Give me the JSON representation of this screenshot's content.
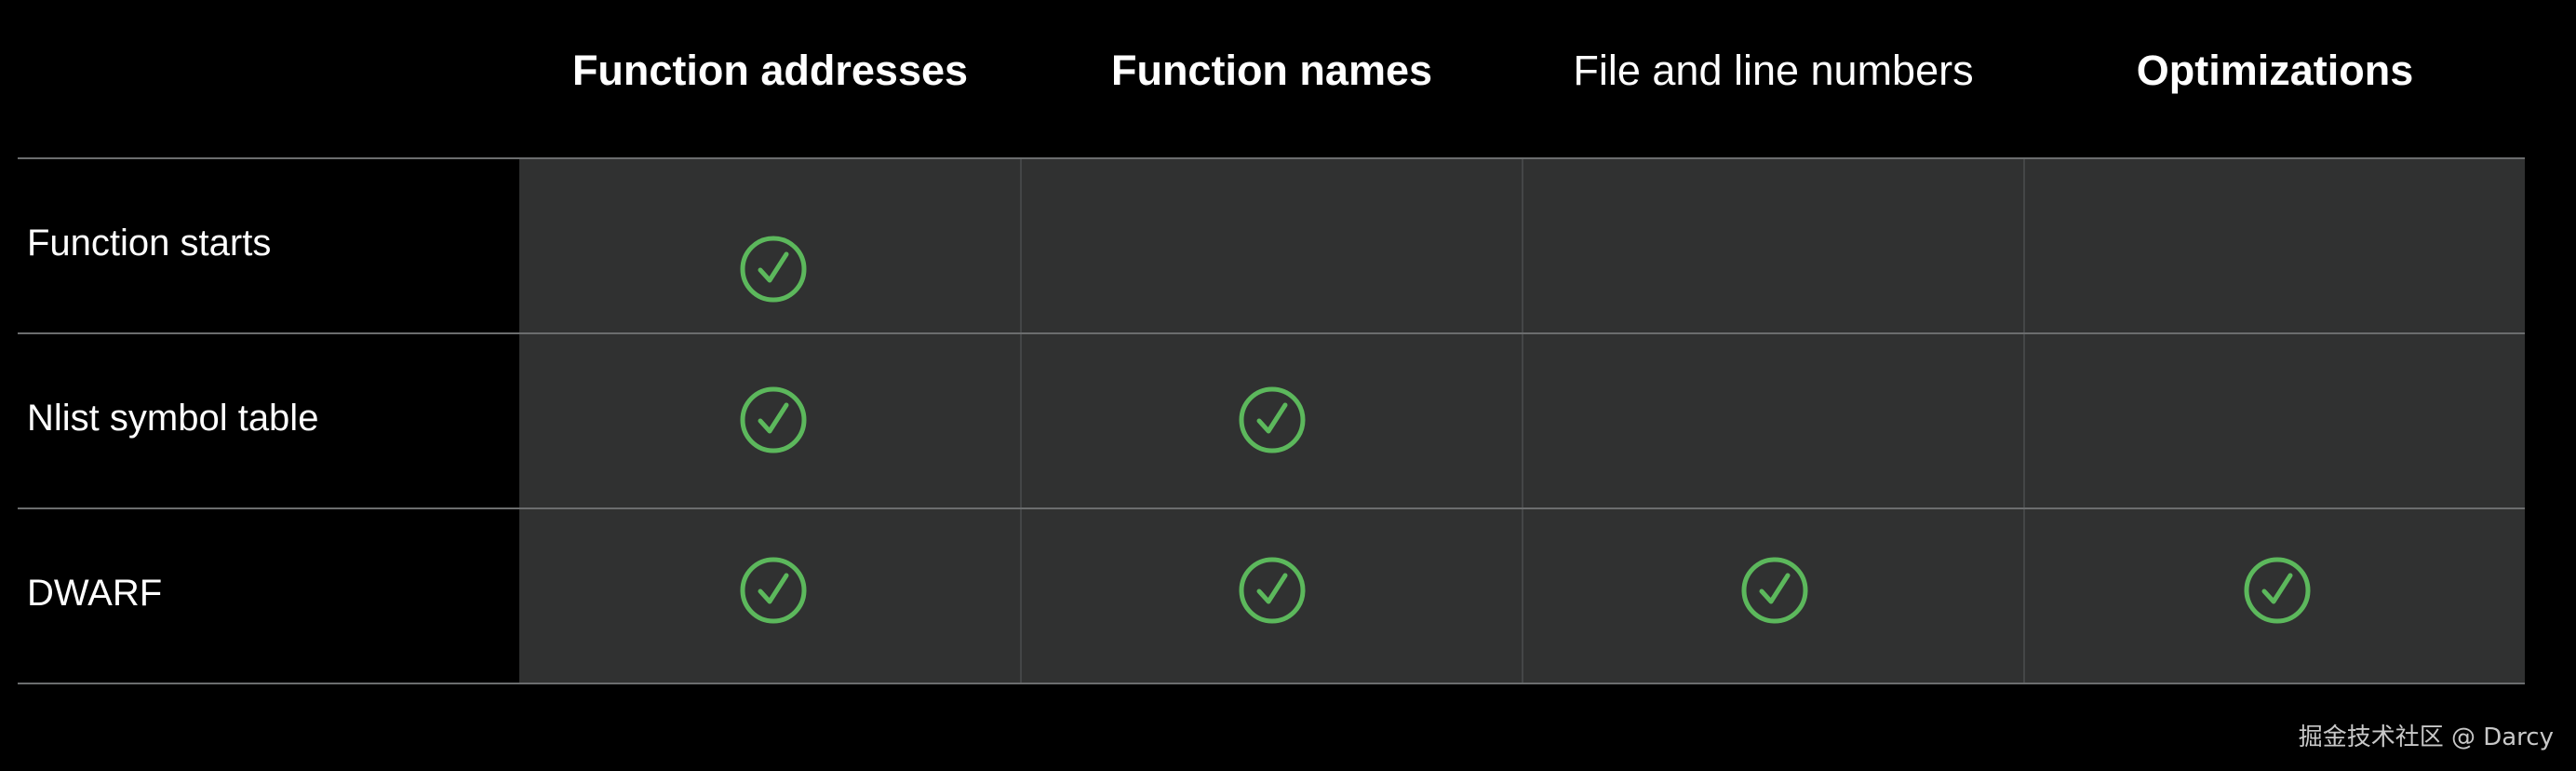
{
  "columns": [
    {
      "label": "Function addresses"
    },
    {
      "label": "Function names"
    },
    {
      "label": "File and line numbers"
    },
    {
      "label": "Optimizations"
    }
  ],
  "rows": [
    {
      "label": "Function starts",
      "checks": [
        true,
        false,
        false,
        false
      ]
    },
    {
      "label": "Nlist symbol table",
      "checks": [
        true,
        true,
        false,
        false
      ]
    },
    {
      "label": "DWARF",
      "checks": [
        true,
        true,
        true,
        true
      ]
    }
  ],
  "icons": {
    "check": "check-circle-icon"
  },
  "colors": {
    "check": "#5cb85c",
    "cell_background": "#303131",
    "background": "#000000"
  },
  "watermark": "掘金技术社区 @ Darcy"
}
